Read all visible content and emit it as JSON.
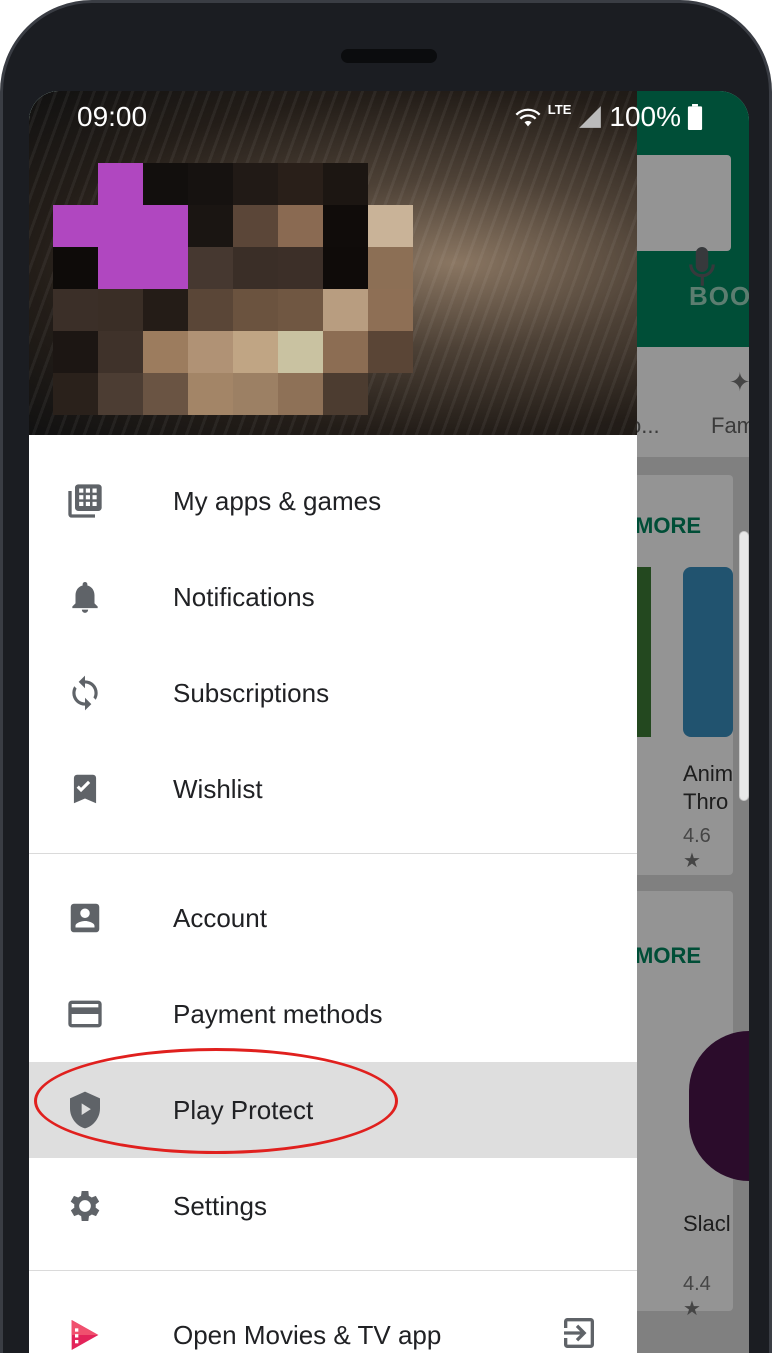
{
  "status_bar": {
    "time": "09:00",
    "network": "LTE",
    "battery": "100%"
  },
  "background": {
    "tab_label": "BOO",
    "chip_1": "o...",
    "chip_2": "Fam",
    "more_1": "MORE",
    "more_2": "MORE",
    "app_title_line1": "Anim",
    "app_title_line2": "Thro",
    "app_rating_1": "4.6 ★",
    "app_name_2": "Slacl",
    "app_rating_2": "4.4 ★",
    "header_color": "#01875f"
  },
  "menu": {
    "group1": [
      {
        "label": "My apps & games",
        "icon": "apps-grid-icon"
      },
      {
        "label": "Notifications",
        "icon": "bell-icon"
      },
      {
        "label": "Subscriptions",
        "icon": "sync-icon"
      },
      {
        "label": "Wishlist",
        "icon": "bookmark-check-icon"
      }
    ],
    "group2": [
      {
        "label": "Account",
        "icon": "account-box-icon"
      },
      {
        "label": "Payment methods",
        "icon": "credit-card-icon"
      },
      {
        "label": "Play Protect",
        "icon": "shield-play-icon",
        "active": true
      },
      {
        "label": "Settings",
        "icon": "gear-icon"
      }
    ],
    "group3": [
      {
        "label": "Open Movies & TV app",
        "icon": "movies-icon",
        "trailing_icon": "exit-app-icon"
      }
    ]
  },
  "colors": {
    "active_row": "#dedede",
    "annotation": "#e0201e",
    "icon": "#5f6368",
    "movies_brand": "#e3245a"
  }
}
